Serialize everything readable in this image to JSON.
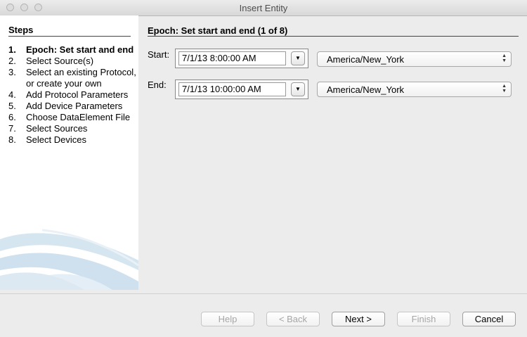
{
  "window": {
    "title": "Insert Entity"
  },
  "sidebar": {
    "title": "Steps",
    "steps": [
      {
        "num": "1.",
        "label": "Epoch: Set start and end"
      },
      {
        "num": "2.",
        "label": "Select Source(s)"
      },
      {
        "num": "3.",
        "label": "Select an existing Protocol, or create your own"
      },
      {
        "num": "4.",
        "label": "Add Protocol Parameters"
      },
      {
        "num": "5.",
        "label": "Add Device Parameters"
      },
      {
        "num": "6.",
        "label": "Choose DataElement File"
      },
      {
        "num": "7.",
        "label": "Select Sources"
      },
      {
        "num": "8.",
        "label": "Select Devices"
      }
    ]
  },
  "main": {
    "title": "Epoch: Set start and end (1 of 8)",
    "start": {
      "label": "Start:",
      "datetime": "7/1/13 8:00:00 AM",
      "timezone": "America/New_York"
    },
    "end": {
      "label": "End:",
      "datetime": "7/1/13 10:00:00 AM",
      "timezone": "America/New_York"
    }
  },
  "buttons": {
    "help": "Help",
    "back": "< Back",
    "next": "Next >",
    "finish": "Finish",
    "cancel": "Cancel"
  },
  "icons": {
    "dropdown": "triangle-down",
    "select_arrows": "up-down-arrows",
    "watermark": "swoosh-graphic"
  },
  "colors": {
    "window_bg": "#ececec",
    "sidebar_bg": "#ffffff",
    "swoosh": "#cfe1ee"
  }
}
